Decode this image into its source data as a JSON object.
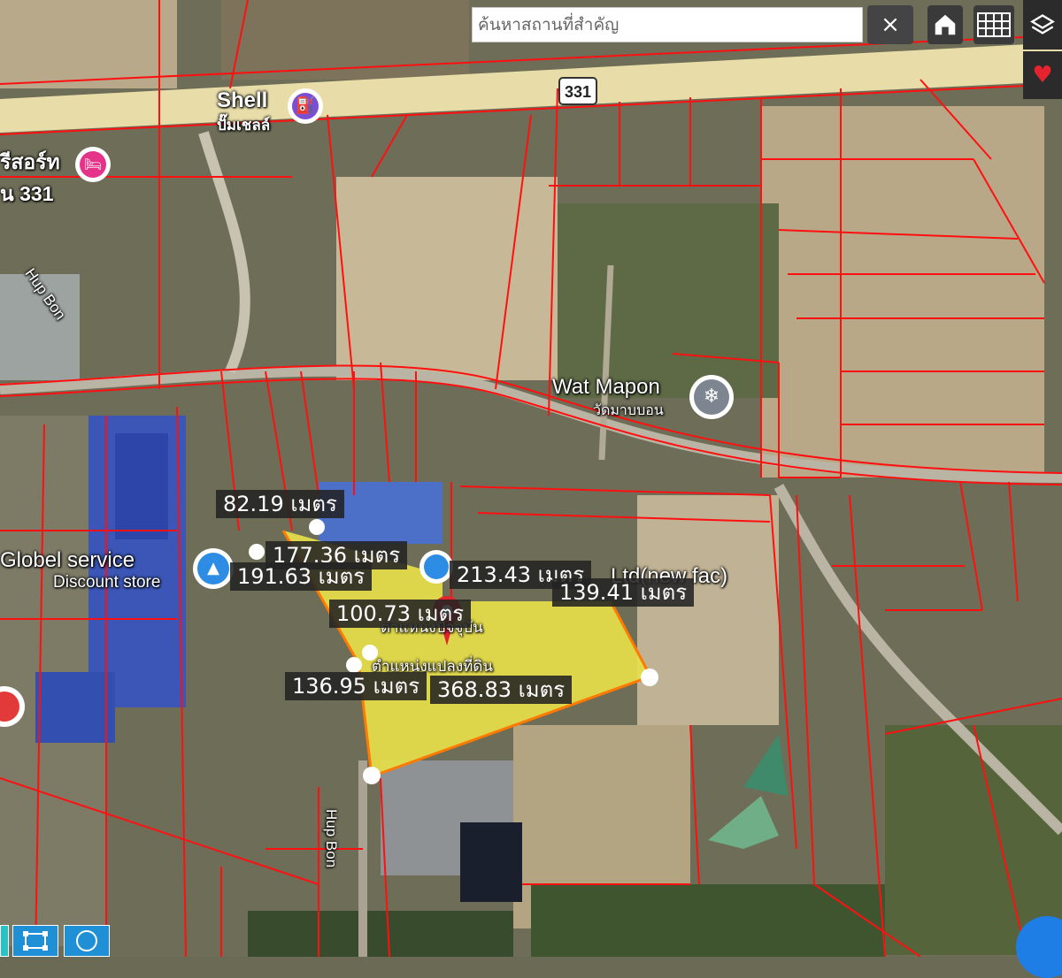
{
  "search": {
    "placeholder": "ค้นหาสถานที่สำคัญ",
    "clear_icon": "close-icon"
  },
  "toolbar": {
    "home_icon": "home-icon",
    "grid_icon": "grid-icon",
    "layers_icon": "layers-icon",
    "favorite_icon": "heart-icon"
  },
  "map": {
    "road_shield": "331",
    "places": [
      {
        "name": "Shell",
        "sub": "ปั๊มเชลล์"
      },
      {
        "name": "รีสอร์ท",
        "sub": "น 331"
      },
      {
        "name": "Hup Bon"
      },
      {
        "name": "Wat Mapon",
        "sub": "วัดมาบบอน"
      },
      {
        "name": "Globel service",
        "sub": "Discount store"
      },
      {
        "name": "Hup Bon"
      },
      {
        "name": "Ltd(new fac)"
      },
      {
        "name": "ตำแหน่งปัจจุบัน"
      },
      {
        "name": "ตำแหน่งแปลงที่ดิน"
      }
    ],
    "measurements": [
      "82.19 เมตร",
      "177.36 เมตร",
      "191.63 เมตร",
      "213.43 เมตร",
      "139.41 เมตร",
      "100.73 เมตร",
      "136.95 เมตร",
      "368.83 เมตร"
    ]
  },
  "tools": {
    "rect_icon": "rectangle-draw-icon",
    "circle_icon": "circle-draw-icon"
  }
}
